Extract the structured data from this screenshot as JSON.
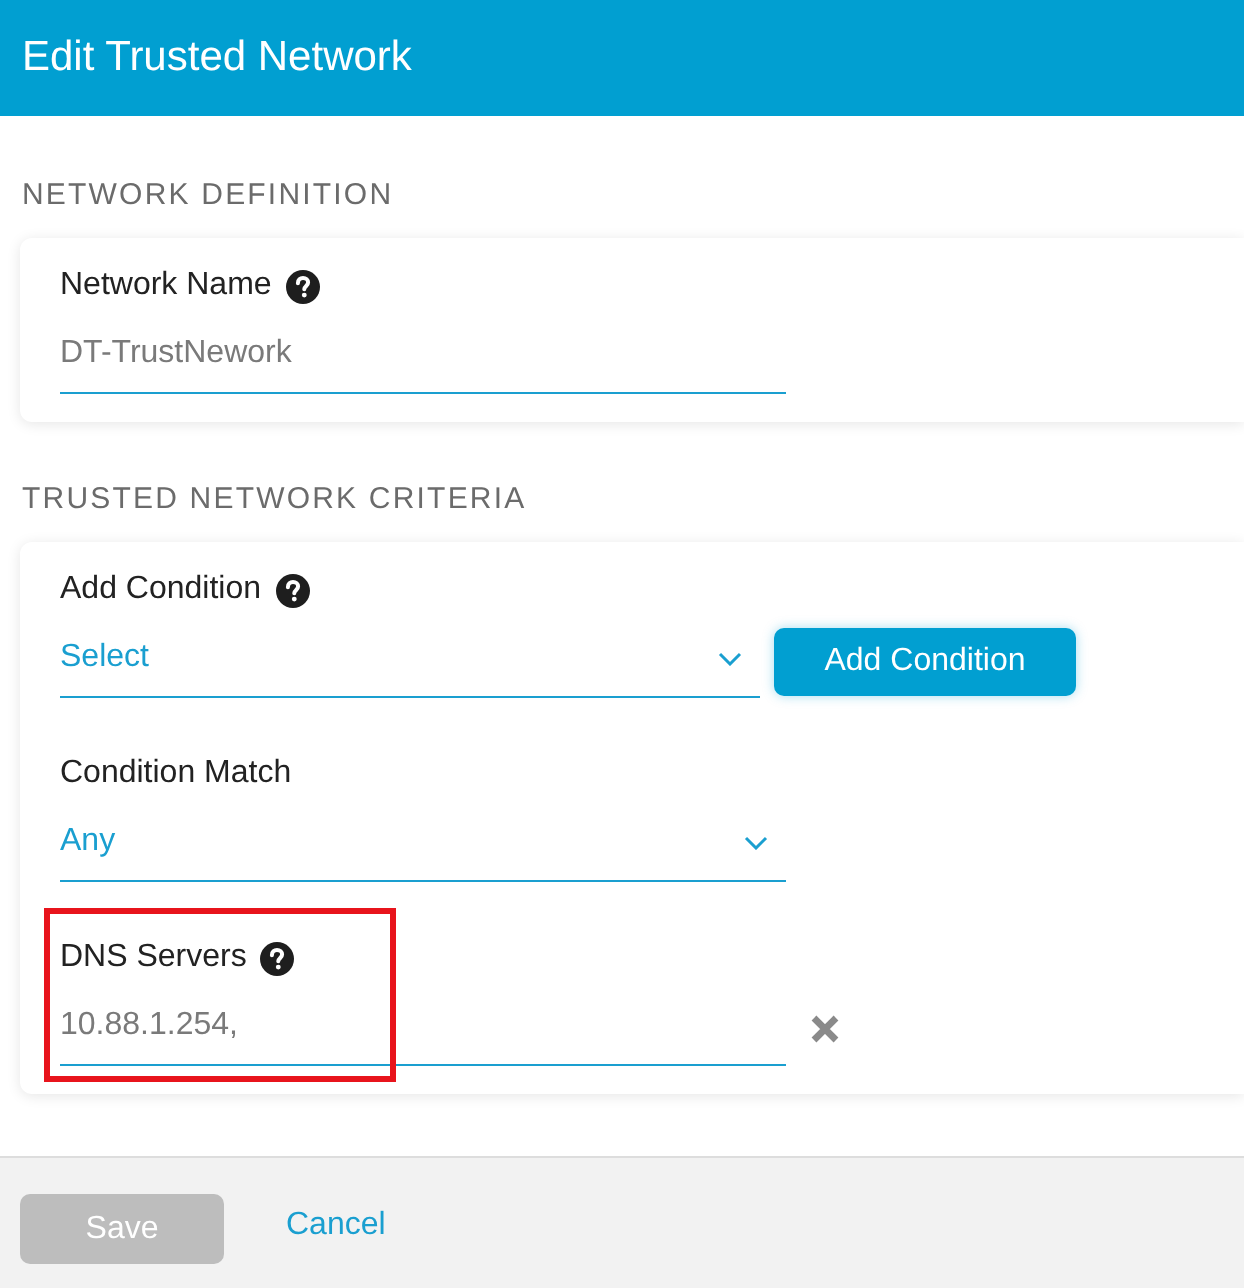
{
  "dialog": {
    "title": "Edit Trusted Network"
  },
  "sections": [
    {
      "heading": "NETWORK DEFINITION",
      "fields": [
        {
          "kind": "text",
          "label": "Network Name",
          "help": true,
          "value": "DT-TrustNework",
          "removable": false,
          "highlighted": false
        }
      ]
    },
    {
      "heading": "TRUSTED NETWORK CRITERIA",
      "fields": [
        {
          "kind": "select",
          "label": "Add Condition",
          "help": true,
          "value": "Select",
          "button": "Add Condition",
          "highlighted": false
        },
        {
          "kind": "select",
          "label": "Condition Match",
          "help": false,
          "value": "Any",
          "highlighted": false
        },
        {
          "kind": "text",
          "label": "DNS Servers",
          "help": true,
          "value": "10.88.1.254,",
          "removable": true,
          "highlighted": true
        }
      ]
    }
  ],
  "footer": {
    "buttons": [
      {
        "kind": "primary",
        "label": "Save",
        "disabled": true
      },
      {
        "kind": "link",
        "label": "Cancel"
      }
    ]
  }
}
